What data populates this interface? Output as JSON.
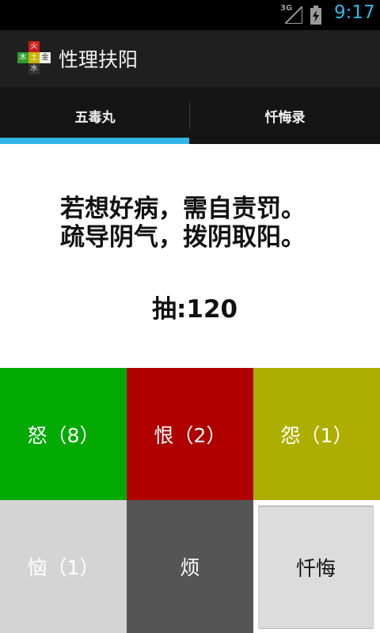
{
  "status_bar": {
    "network": "3G",
    "time": "9:17"
  },
  "app": {
    "title": "性理扶阳",
    "icon_chars": {
      "top": "火",
      "left": "木",
      "center": "土",
      "right": "金",
      "bottom": "水"
    }
  },
  "tabs": [
    {
      "label": "五毒丸",
      "selected": true
    },
    {
      "label": "忏悔录",
      "selected": false
    }
  ],
  "content": {
    "line1": "若想好病，需自责罚。",
    "line2": "疏导阴气，拨阴取阳。",
    "draw": "抽:120"
  },
  "tiles": {
    "anger": "怒（8）",
    "hate": "恨（2）",
    "resentment": "怨（1）",
    "vexation": "恼（1）",
    "annoyance": "烦",
    "repent": "忏悔"
  },
  "colors": {
    "accent": "#33b5e5",
    "anger": "#00aa00",
    "hate": "#b00000",
    "resentment": "#aeae00",
    "vexation": "#d4d4d4",
    "annoyance": "#555555",
    "repent_button": "#dcdcdc"
  }
}
